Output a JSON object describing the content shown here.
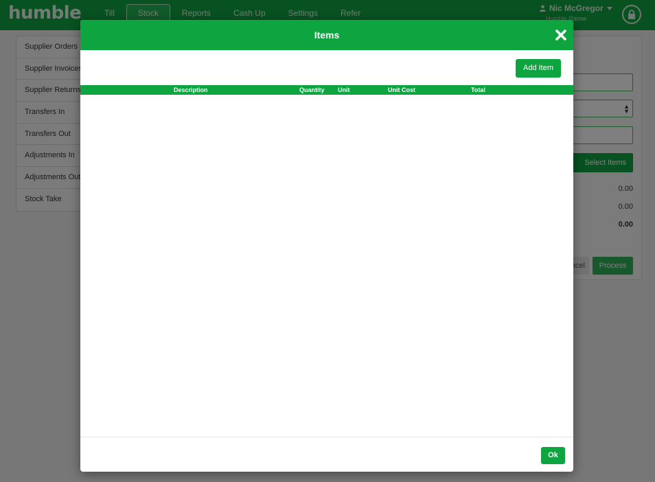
{
  "app": {
    "logo": "humble"
  },
  "nav": {
    "tabs": [
      "Till",
      "Stock",
      "Reports",
      "Cash Up",
      "Settings",
      "Refer"
    ],
    "active": "Stock"
  },
  "user": {
    "name": "Nic McGregor",
    "location": "Humble Parow"
  },
  "sidebar": {
    "items": [
      "Supplier Orders",
      "Supplier Invoices",
      "Supplier Returns",
      "Transfers In",
      "Transfers Out",
      "Adjustments In",
      "Adjustments Out",
      "Stock Take"
    ]
  },
  "panel": {
    "select_items_label": "Select Items",
    "amounts": [
      "0.00",
      "0.00",
      "0.00"
    ],
    "cancel_label": "Cancel",
    "process_label": "Process"
  },
  "modal": {
    "title": "Items",
    "add_item_label": "Add Item",
    "columns": [
      "Description",
      "Quantity",
      "Unit",
      "Unit Cost",
      "Total"
    ],
    "rows": [],
    "ok_label": "Ok"
  },
  "colors": {
    "brand_green": "#0ea540",
    "backdrop": "rgba(0,0,0,0.5)"
  },
  "icons": {
    "close": "close-icon",
    "lock": "lock-icon",
    "user": "user-icon",
    "caret": "caret-down-icon"
  }
}
